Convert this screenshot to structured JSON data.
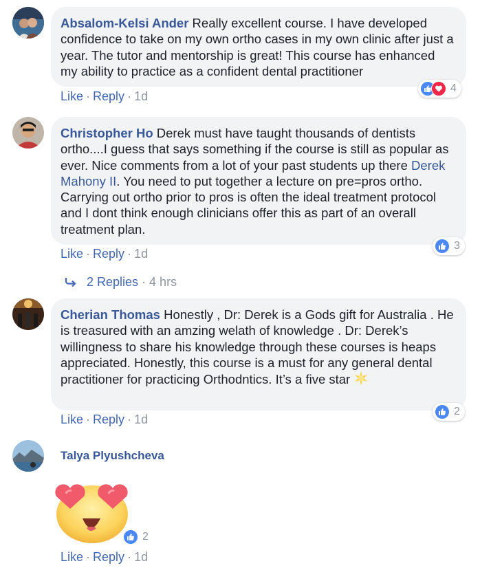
{
  "comments": [
    {
      "author": "Absalom-Kelsi Ander",
      "text": " Really excellent course. I have developed confidence to take on my own ortho cases in my own clinic after just a year. The tutor and mentorship is great! This course has enhanced my ability to practice as a confident dental practitioner",
      "reaction_count": "4",
      "like": "Like",
      "reply": "Reply",
      "time": "1d"
    },
    {
      "author": "Christopher Ho",
      "text_before": " Derek must have taught thousands of dentists ortho....I guess that says something if the course is still as popular as ever. Nice comments from a lot of your past students up there ",
      "mention": "Derek Mahony II",
      "text_after": ". You need to put together a lecture on pre=pros ortho. Carrying out ortho prior to pros is often the ideal treatment protocol and I dont think enough clinicians offer this as part of an overall treatment plan.",
      "reaction_count": "3",
      "like": "Like",
      "reply": "Reply",
      "time": "1d",
      "replies": {
        "label": "2 Replies",
        "time": "4 hrs"
      }
    },
    {
      "author": "Cherian Thomas",
      "text": " Honestly , Dr: Derek is a Gods gift for Australia . He is treasured with an amzing welath of knowledge . Dr: Derek’s willingness to share his knowledge through these courses is heaps appreciated. Honestly, this course is a must for any general dental practitioner for practicing Orthodntics. It’s a five star ",
      "reaction_count": "2",
      "like": "Like",
      "reply": "Reply",
      "time": "1d"
    },
    {
      "author": "Talya Plyushcheva",
      "reaction_count": "2",
      "like": "Like",
      "reply": "Reply",
      "time": "1d"
    }
  ],
  "colors": {
    "link": "#385898",
    "action": "#4267b2",
    "bubble": "#f2f3f5",
    "muted": "#90949c",
    "like_blue": "#4b88f5",
    "love_red": "#f0284a"
  },
  "icons": {
    "like": "thumbs-up-icon",
    "love": "heart-icon",
    "reply_arrow": "reply-arrow-icon",
    "sparkle": "star-emoji-icon",
    "sticker": "heart-eyes-emoji-icon"
  }
}
